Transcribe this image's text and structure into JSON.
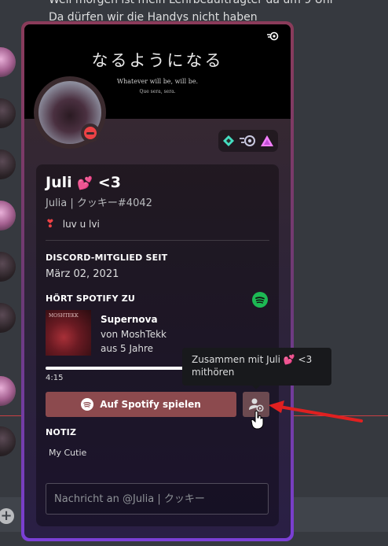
{
  "background_chat": {
    "line1": "Weil morgen ist mein Lehrbeauftragter da um 9 Uhr",
    "line2": "Da dürfen wir die Handys nicht haben"
  },
  "banner": {
    "title": "なるようになる",
    "subtitle": "Whatever will be, will be.",
    "subtitle2": "Que sera, sera."
  },
  "profile": {
    "display_name": "Juli",
    "name_suffix": "<3",
    "name_emoji": "💕",
    "tag": "Julia | クッキー#4042",
    "status_presence": "dnd",
    "custom_status_emoji": "❣",
    "custom_status_text": "luv u lvi",
    "badges": [
      "hypesquad-balance-icon",
      "nitro-boost-icon",
      "early-supporter-icon"
    ]
  },
  "member_since": {
    "heading": "DISCORD-MITGLIED SEIT",
    "date": "März 02, 2021"
  },
  "spotify": {
    "heading": "HÖRT SPOTIFY ZU",
    "album_art_text": "MOSHTEKK",
    "song": "Supernova",
    "artist": "von MoshTekk",
    "album": "aus 5 Jahre",
    "elapsed": "4:15",
    "progress_fraction": 0.75,
    "play_button": "Auf Spotify spielen"
  },
  "tooltip": {
    "line1": "Zusammen mit Juli 💕 <3",
    "line2": "mithören"
  },
  "note": {
    "heading": "NOTIZ",
    "text": "My Cutie"
  },
  "message": {
    "placeholder": "Nachricht an @Julia | クッキー"
  },
  "colors": {
    "spotify_green": "#1db954",
    "dnd_red": "#ed4245",
    "popout_border_top": "#8a3b5a",
    "popout_border_bottom": "#7b3fd6",
    "annotation_arrow": "#e02020"
  }
}
